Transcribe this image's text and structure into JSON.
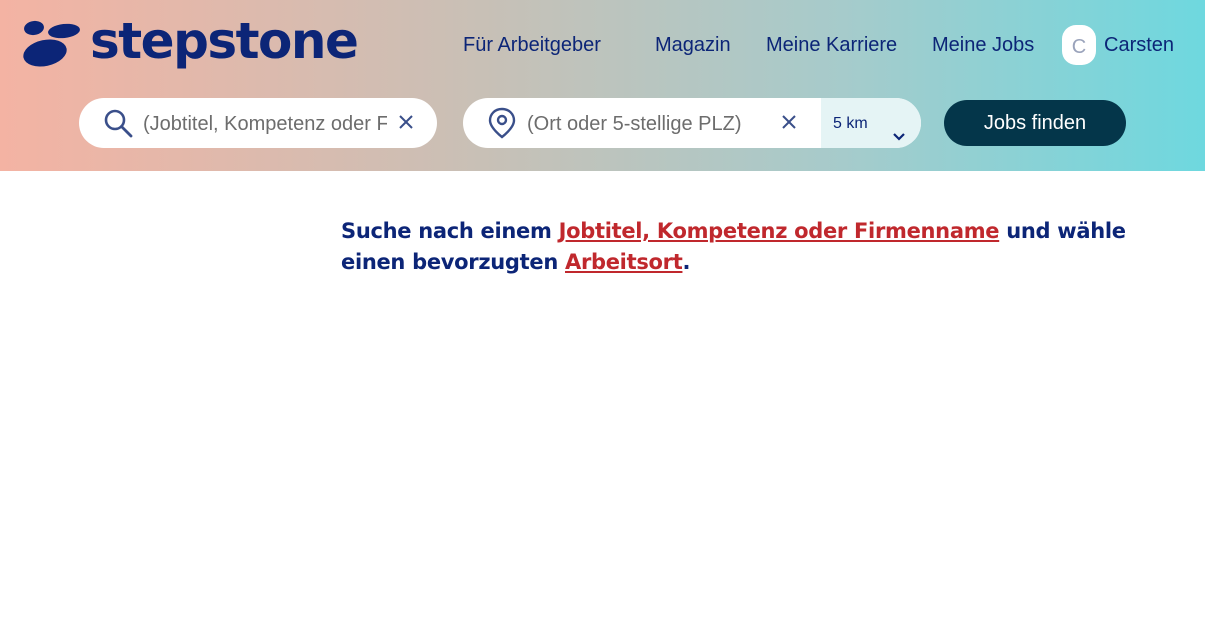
{
  "header": {
    "logo_text": "stepstone",
    "nav": [
      {
        "label": "Für Arbeitgeber"
      },
      {
        "label": "Magazin"
      },
      {
        "label": "Meine Karriere"
      },
      {
        "label": "Meine Jobs"
      }
    ],
    "user": {
      "initial": "C",
      "name": "Carsten"
    }
  },
  "search": {
    "keyword_placeholder": "(Jobtitel, Kompetenz oder Firmenname)",
    "location_placeholder": "(Ort oder 5-stellige PLZ)",
    "radius_value": "5 km",
    "submit_label": "Jobs finden"
  },
  "hint": {
    "text_1": "Suche nach einem ",
    "link_1": "Jobtitel, Kompetenz oder Firmenname",
    "text_2": " und wähle einen bevorzugten ",
    "link_2": "Arbeitsort",
    "text_3": "."
  },
  "colors": {
    "brand": "#0c2577",
    "cta": "#04364a",
    "link": "#c0282d"
  },
  "icons": {
    "search": "search-icon",
    "location": "location-pin-icon",
    "clear": "close-icon",
    "dropdown": "chevron-down-icon"
  }
}
